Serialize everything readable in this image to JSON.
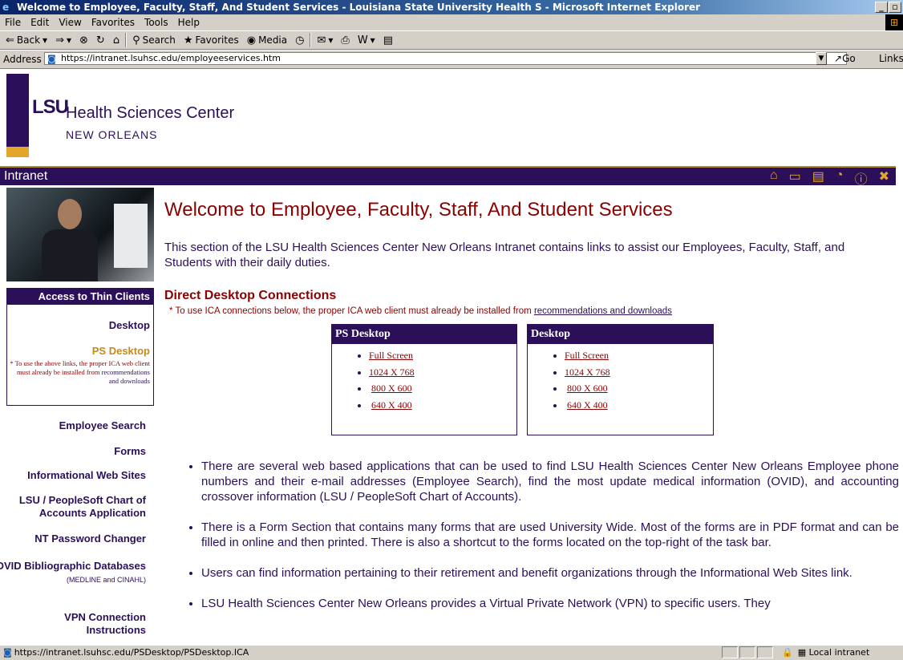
{
  "window": {
    "title": "Welcome to Employee, Faculty, Staff, And Student Services - Louisiana State University Health S - Microsoft Internet Explorer"
  },
  "menu": [
    "File",
    "Edit",
    "View",
    "Favorites",
    "Tools",
    "Help"
  ],
  "toolbar": {
    "back": "Back",
    "search": "Search",
    "favorites": "Favorites",
    "media": "Media"
  },
  "address": {
    "label": "Address",
    "url": "https://intranet.lsuhsc.edu/employeeservices.htm",
    "go": "Go",
    "links": "Links"
  },
  "header": {
    "logo_lsu": "LSU",
    "org": "Health Sciences Center",
    "city": "NEW ORLEANS",
    "intranet": "Intranet",
    "icons": [
      "building-icon",
      "inbox-icon",
      "document-icon",
      "phone-icon",
      "info-icon",
      "tools-icon"
    ]
  },
  "sidebar": {
    "access_heading": "Access to Thin Clients",
    "desktop": "Desktop",
    "ps_desktop": "PS Desktop",
    "note_text": "* To use the above links, the proper ICA web client must already be installed from",
    "note_link": "recommendations and downloads",
    "links": [
      {
        "label": "Employee Search",
        "sub": ""
      },
      {
        "label": "Forms",
        "sub": ""
      },
      {
        "label": "Informational Web Sites",
        "sub": ""
      },
      {
        "label": "LSU / PeopleSoft Chart of Accounts Application",
        "sub": ""
      },
      {
        "label": "NT Password Changer",
        "sub": ""
      },
      {
        "label": "OVID Bibliographic Databases",
        "sub": "(MEDLINE and CINAHL)"
      },
      {
        "label": "VPN Connection Instructions",
        "sub": ""
      }
    ]
  },
  "main": {
    "title": "Welcome to Employee, Faculty, Staff, And Student Services",
    "intro": "This section of the LSU Health Sciences Center New Orleans Intranet contains links to assist our Employees, Faculty, Staff, and Students with their daily duties.",
    "ddc_heading": "Direct Desktop Connections",
    "ddc_note": "* To use ICA connections below, the proper ICA web client must already be installed from",
    "ddc_note_link": "recommendations and downloads",
    "boxes": [
      {
        "title": "PS Desktop",
        "items": [
          "Full Screen",
          "1024 X 768",
          "800 X 600",
          "640 X 400"
        ]
      },
      {
        "title": "Desktop",
        "items": [
          "Full Screen",
          "1024 X 768",
          "800 X 600",
          "640 X 400"
        ]
      }
    ],
    "bullets": [
      "There are several web based applications that can be used to find LSU Health Sciences Center New Orleans Employee phone numbers and their e-mail addresses (Employee Search), find the most update medical information (OVID), and accounting crossover information (LSU / PeopleSoft Chart of Accounts).",
      "There is a Form Section that contains many forms that are used University Wide. Most of the forms are in PDF format and can be filled in online and then printed. There is also a shortcut to the forms located on the top-right of the task bar.",
      "Users can find information pertaining to their retirement and benefit organizations through the Informational Web Sites link.",
      "LSU Health Sciences Center New Orleans provides a Virtual Private Network (VPN) to specific users. They"
    ]
  },
  "status": {
    "url": "https://intranet.lsuhsc.edu/PSDesktop/PSDesktop.ICA",
    "zone": "Local intranet"
  },
  "colors": {
    "purple": "#2b1059",
    "gold": "#e2a62b",
    "maroon": "#8b0000"
  }
}
